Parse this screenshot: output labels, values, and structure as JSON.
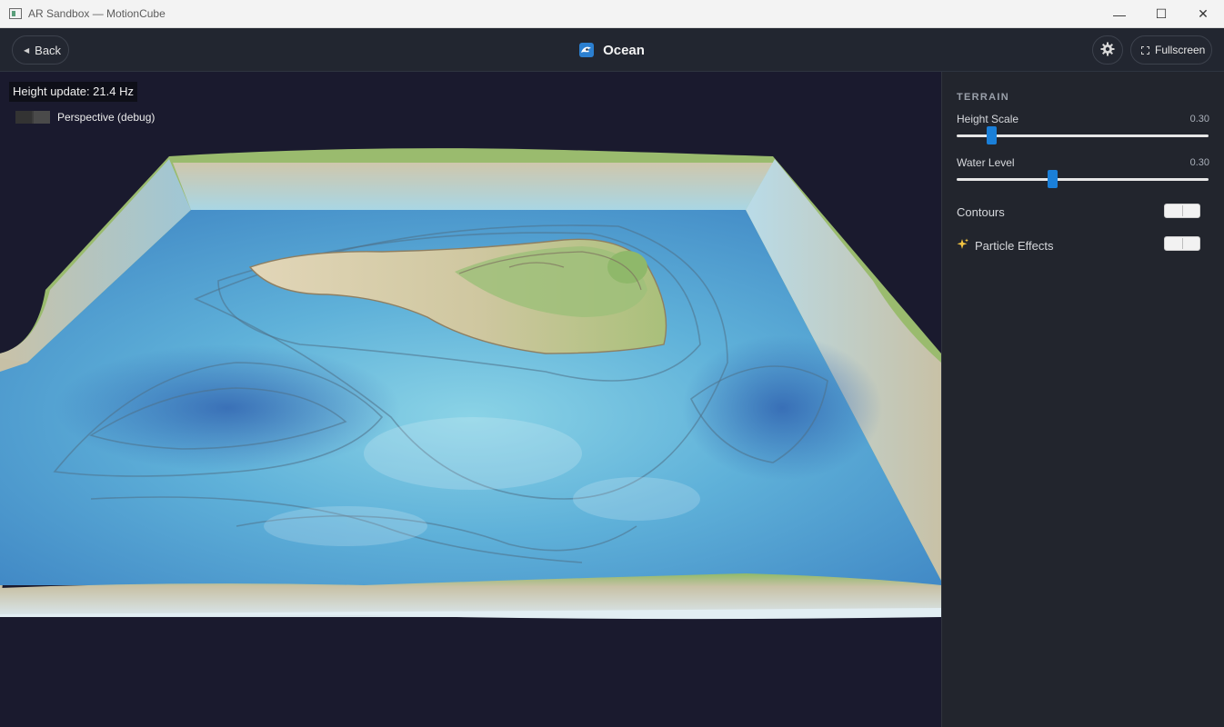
{
  "window": {
    "title": "AR Sandbox — MotionCube",
    "controls": {
      "minimize": "—",
      "maximize": "☐",
      "close": "✕"
    }
  },
  "header": {
    "back_label": "Back",
    "mode_title": "Ocean",
    "fullscreen_label": "Fullscreen"
  },
  "viewport": {
    "height_update": "Height update: 21.4 Hz",
    "perspective_label": "Perspective (debug)"
  },
  "panel": {
    "section_title": "TERRAIN",
    "height_scale": {
      "label": "Height Scale",
      "value": "0.30",
      "fraction": 0.14
    },
    "water_level": {
      "label": "Water Level",
      "value": "0.30",
      "fraction": 0.38
    },
    "contours_label": "Contours",
    "particle_label": "Particle Effects"
  },
  "colors": {
    "accent": "#1a7fd8",
    "viewport_bg": "#1a1a2e",
    "panel_bg": "#22252d",
    "header_bg": "#222630"
  },
  "icons": {
    "back": "triangle-left-icon",
    "mode": "wave-icon",
    "settings": "gear-icon",
    "fullscreen": "fullscreen-icon",
    "particles": "sparkle-icon"
  }
}
